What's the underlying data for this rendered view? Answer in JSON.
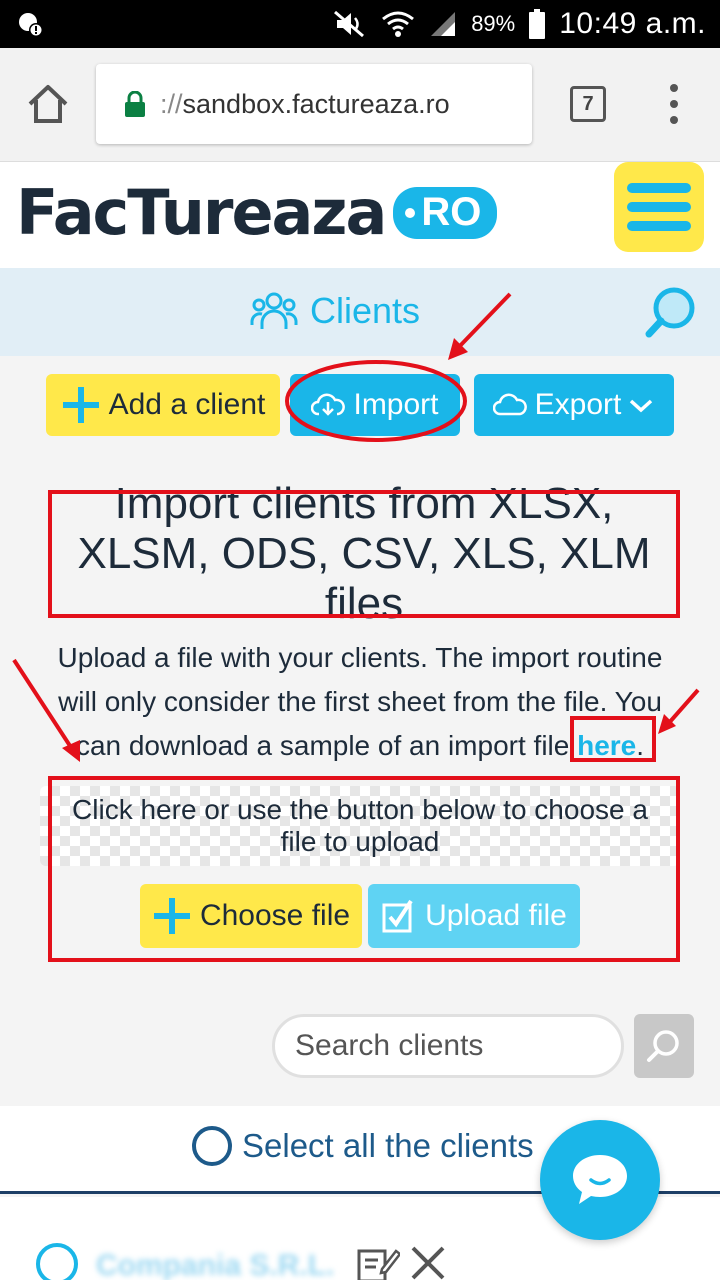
{
  "statusbar": {
    "battery": "89%",
    "time": "10:49 a.m."
  },
  "browser": {
    "url_scheme": "://",
    "url_host": "sandbox.factureaza.ro",
    "tab_count": "7"
  },
  "site": {
    "logo_text": "FacTureaza",
    "logo_suffix": "RO"
  },
  "page": {
    "title": "Clients"
  },
  "actions": {
    "add_label": "Add a client",
    "import_label": "Import",
    "export_label": "Export"
  },
  "import": {
    "heading": "Import clients from XLSX, XLSM, ODS, CSV, XLS, XLM files",
    "desc_before": "Upload a file with your clients. The import routine will only consider the first sheet from the file. You can download a sample of an import file ",
    "desc_link": "here",
    "desc_after": ".",
    "dropzone_text": "Click here or use the button below to choose a file to upload",
    "choose_label": "Choose file",
    "upload_label": "Upload file"
  },
  "search": {
    "placeholder": "Search clients"
  },
  "list": {
    "select_all_label": "Select all the clients",
    "rows": [
      {
        "name": "Compania S.R.L."
      }
    ]
  },
  "colors": {
    "accent": "#1ab6e8",
    "yellow": "#ffe84a",
    "navy": "#1d2b3a",
    "annotation_red": "#e3101a"
  }
}
